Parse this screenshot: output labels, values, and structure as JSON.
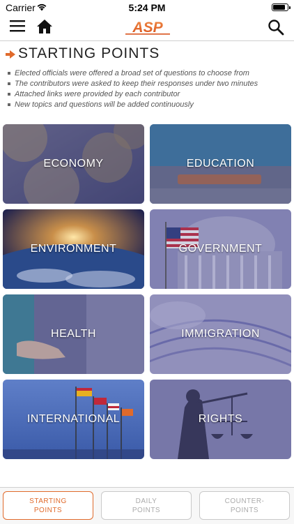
{
  "status": {
    "carrier": "Carrier",
    "time": "5:24 PM"
  },
  "nav": {
    "logo_text": "ASP",
    "logo_color": "#e8632a"
  },
  "heading": {
    "title": "STARTING POINTS",
    "accent": "#e06a2b"
  },
  "bullets": [
    "Elected officials were offered a broad set of questions to choose from",
    "The contributors were asked to keep their responses under two minutes",
    "Attached links were provided by each contributor",
    "New topics and questions will be added continuously"
  ],
  "topics": [
    {
      "label": "ECONOMY"
    },
    {
      "label": "EDUCATION"
    },
    {
      "label": "ENVIRONMENT"
    },
    {
      "label": "GOVERNMENT"
    },
    {
      "label": "HEALTH"
    },
    {
      "label": "IMMIGRATION"
    },
    {
      "label": "INTERNATIONAL"
    },
    {
      "label": "RIGHTS"
    }
  ],
  "tabs": [
    {
      "line1": "STARTING",
      "line2": "POINTS",
      "active": true
    },
    {
      "line1": "DAILY",
      "line2": "POINTS",
      "active": false
    },
    {
      "line1": "COUNTER-",
      "line2": "POINTS",
      "active": false
    }
  ]
}
